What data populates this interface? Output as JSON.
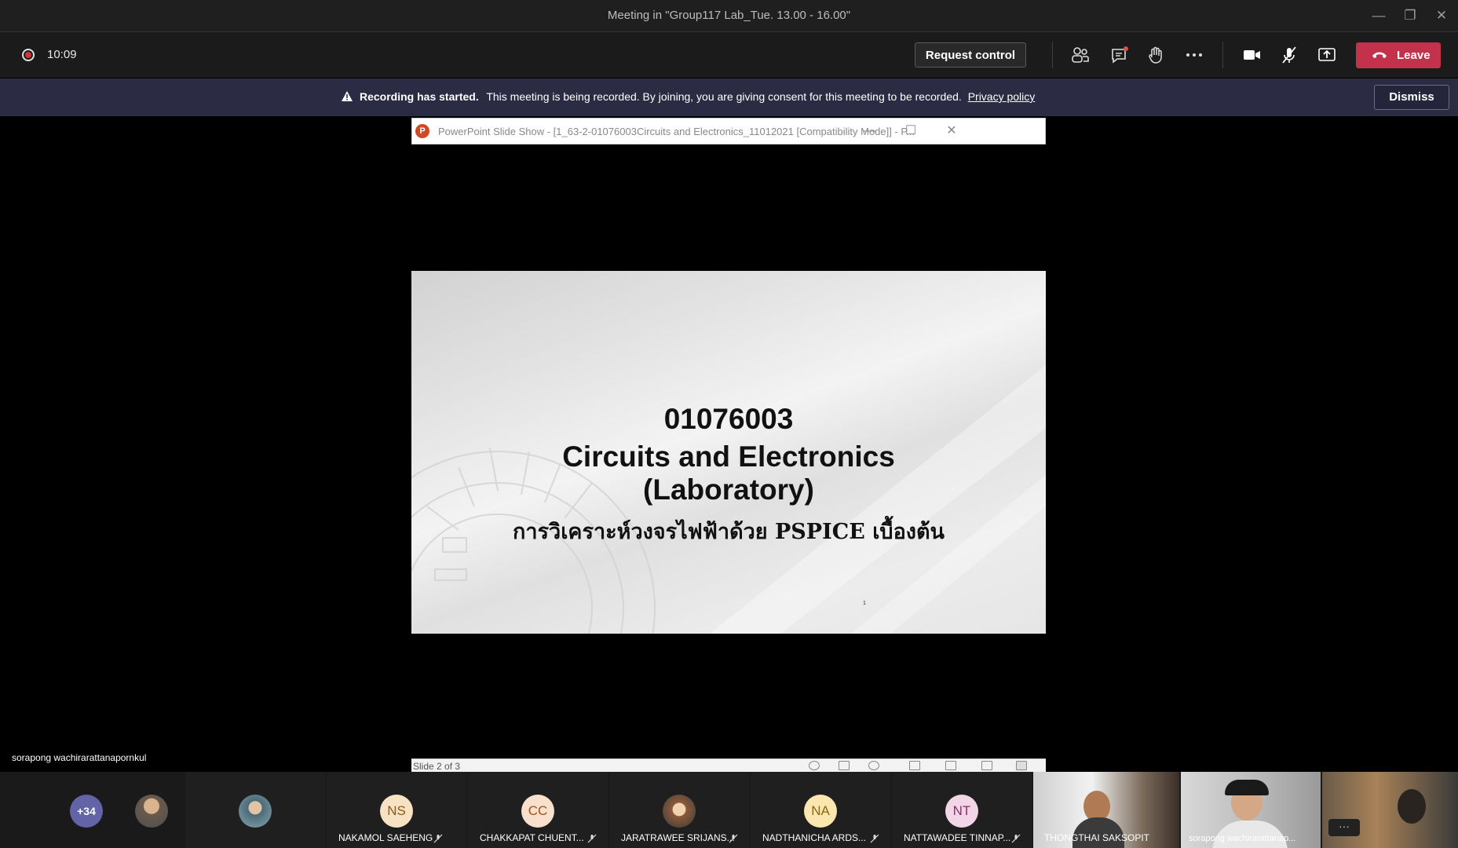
{
  "window": {
    "title": "Meeting in \"Group117 Lab_Tue. 13.00 - 16.00\""
  },
  "toolbar": {
    "timer": "10:09",
    "request_control_label": "Request control",
    "leave_label": "Leave",
    "icons": [
      "participants-icon",
      "chat-icon",
      "raise-hand-icon",
      "more-options-icon",
      "camera-icon",
      "mic-off-icon",
      "share-screen-icon",
      "phone-hangup-icon"
    ],
    "leave_color": "#c4314b"
  },
  "banner": {
    "title": "Recording has started.",
    "message": "This meeting is being recorded. By joining, you are giving consent for this meeting to be recorded.",
    "link": "Privacy policy",
    "dismiss_label": "Dismiss",
    "background": "#2b2c43"
  },
  "ppt": {
    "window_title": "PowerPoint Slide Show - [1_63-2-01076003Circuits and Electronics_11012021 [Compatibility Mode]] - P...",
    "logo_letter": "P",
    "slide": {
      "code": "01076003",
      "title_line1": "Circuits and Electronics",
      "title_line2": "(Laboratory)",
      "thai_subtitle": "การวิเคราะห์วงจรไฟฟ้าด้วย PSPICE เบื้องต้น",
      "page_number": "1"
    },
    "status": "Slide 2 of 3"
  },
  "presenter_name": "sorapong wachirarattanapornkul",
  "participants": {
    "more_count": "+34",
    "tiles": [
      {
        "initials": "NS",
        "name": "NAKAMOL SAEHENG",
        "bg": "#f7e3c4",
        "fg": "#8a5a13"
      },
      {
        "initials": "CC",
        "name": "CHAKKAPAT CHUENT...",
        "bg": "#f9e0cc",
        "fg": "#9a5520"
      },
      {
        "initials": "",
        "name": "JARATRAWEE SRIJANS..."
      },
      {
        "initials": "NA",
        "name": "NADTHANICHA ARDS...",
        "bg": "#fbe6b0",
        "fg": "#8a6a10"
      },
      {
        "initials": "NT",
        "name": "NATTAWADEE TINNAP...",
        "bg": "#f2d6e8",
        "fg": "#8e2f6c"
      }
    ],
    "video_tiles": [
      "THONGTHAI SAKSOPIT",
      "sorapong wachirarattanap..."
    ]
  }
}
